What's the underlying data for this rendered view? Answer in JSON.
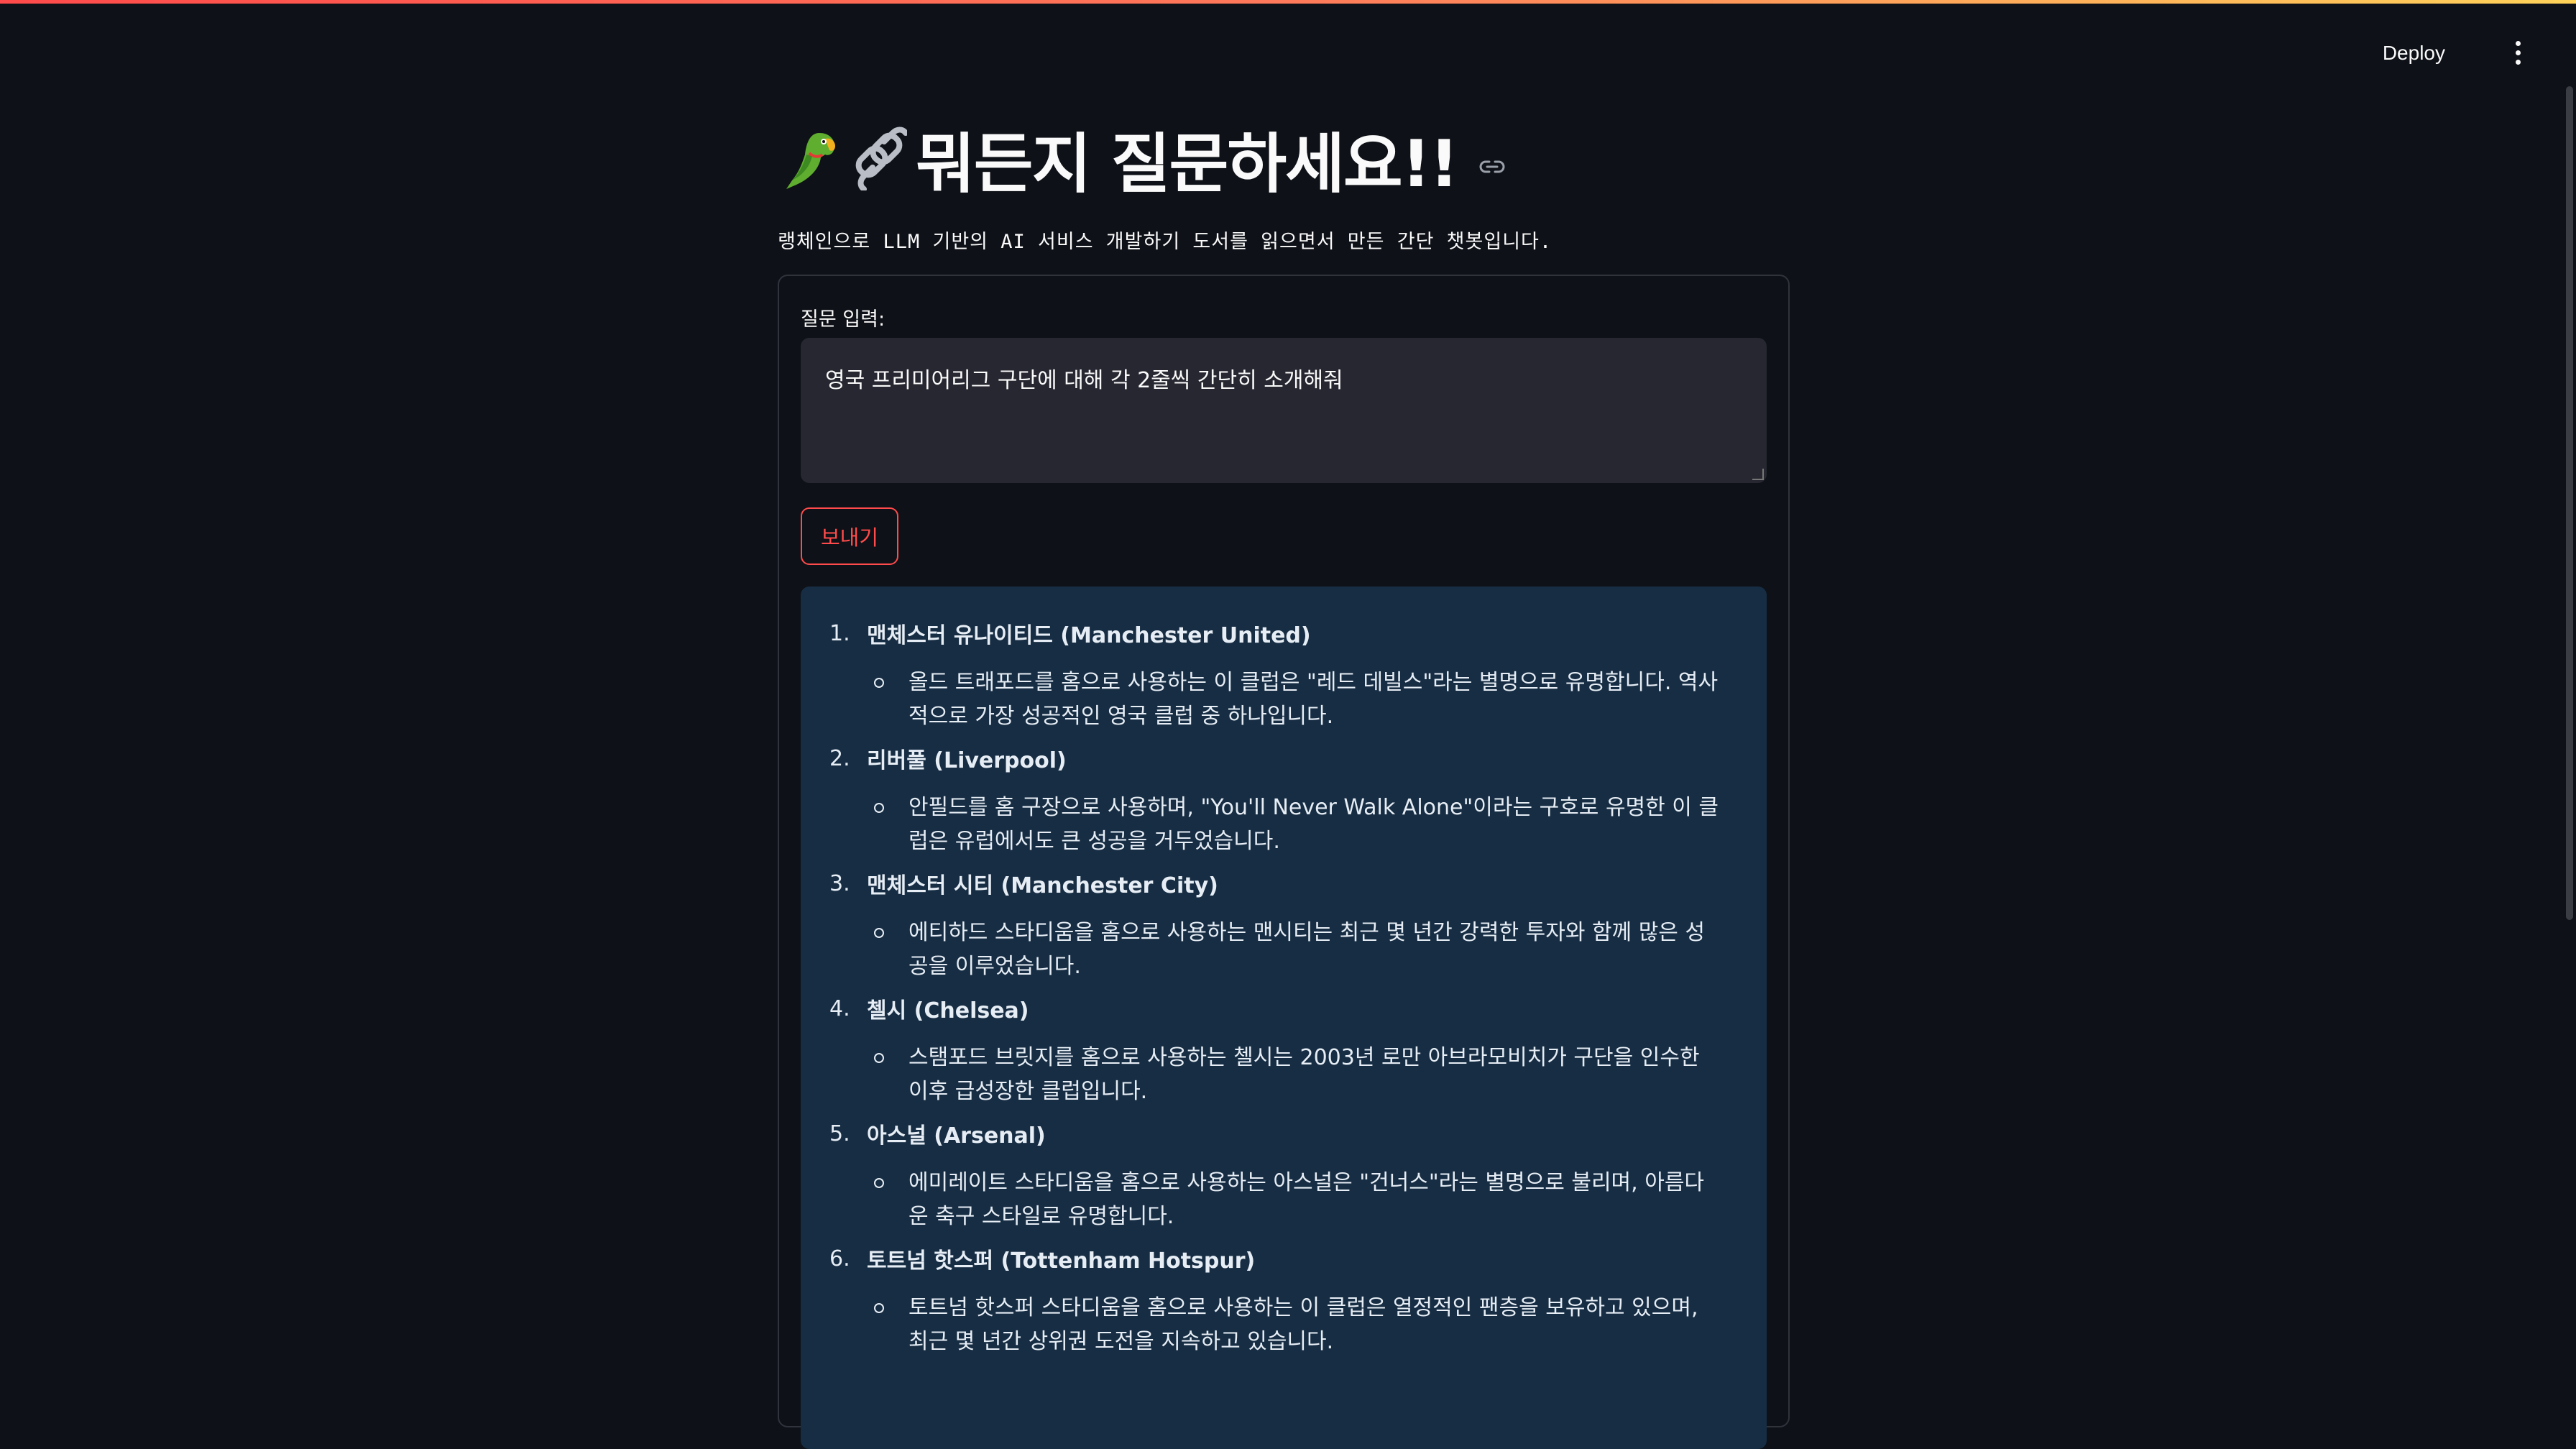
{
  "header": {
    "deploy_label": "Deploy"
  },
  "page": {
    "title": "뭐든지 질문하세요!!",
    "subtitle": "랭체인으로 LLM 기반의 AI 서비스 개발하기 도서를 읽으면서 만든 간단 챗봇입니다.",
    "title_icons": [
      "parrot-emoji",
      "chain-link-emoji",
      "anchor-link-icon"
    ]
  },
  "form": {
    "label": "질문 입력:",
    "input_value": "영국 프리미어리그 구단에 대해 각 2줄씩 간단히 소개해줘",
    "send_label": "보내기"
  },
  "answer": {
    "items": [
      {
        "num": "1.",
        "title": "맨체스터 유나이티드 (Manchester United)",
        "desc": "올드 트래포드를 홈으로 사용하는 이 클럽은 \"레드 데빌스\"라는 별명으로 유명합니다. 역사적으로 가장 성공적인 영국 클럽 중 하나입니다."
      },
      {
        "num": "2.",
        "title": "리버풀 (Liverpool)",
        "desc": "안필드를 홈 구장으로 사용하며, \"You'll Never Walk Alone\"이라는 구호로 유명한 이 클럽은 유럽에서도 큰 성공을 거두었습니다."
      },
      {
        "num": "3.",
        "title": "맨체스터 시티 (Manchester City)",
        "desc": "에티하드 스타디움을 홈으로 사용하는 맨시티는 최근 몇 년간 강력한 투자와 함께 많은 성공을 이루었습니다."
      },
      {
        "num": "4.",
        "title": "첼시 (Chelsea)",
        "desc": "스탬포드 브릿지를 홈으로 사용하는 첼시는 2003년 로만 아브라모비치가 구단을 인수한 이후 급성장한 클럽입니다."
      },
      {
        "num": "5.",
        "title": "아스널 (Arsenal)",
        "desc": "에미레이트 스타디움을 홈으로 사용하는 아스널은 \"건너스\"라는 별명으로 불리며, 아름다운 축구 스타일로 유명합니다."
      },
      {
        "num": "6.",
        "title": "토트넘 핫스퍼 (Tottenham Hotspur)",
        "desc": "토트넘 핫스퍼 스타디움을 홈으로 사용하는 이 클럽은 열정적인 팬층을 보유하고 있으며, 최근 몇 년간 상위권 도전을 지속하고 있습니다."
      }
    ]
  },
  "colors": {
    "background": "#0e1117",
    "accent": "#ff4b4b",
    "input_bg": "#262730",
    "answer_bg": "#172d43"
  }
}
